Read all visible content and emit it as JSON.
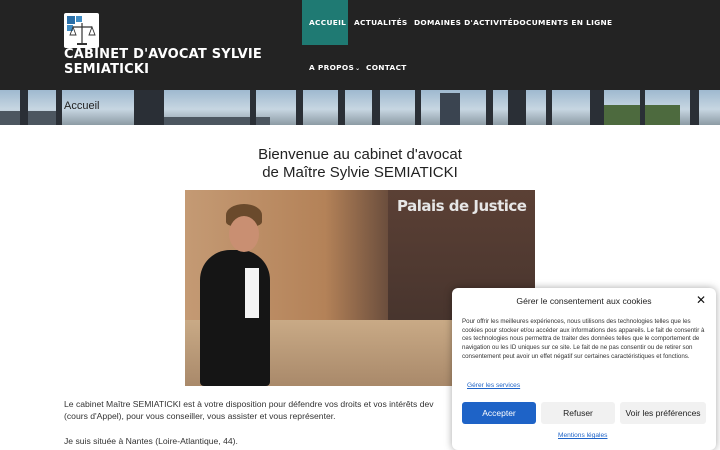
{
  "header": {
    "site_title": "CABINET D'AVOCAT SYLVIE SEMIATICKI",
    "nav": {
      "accueil": "ACCUEIL",
      "actualites": "ACTUALITÉS",
      "domaines": "DOMAINES D'ACTIVITÉ",
      "documents": "DOCUMENTS EN LIGNE",
      "apropos": "A PROPOS",
      "contact": "CONTACT"
    },
    "active_color": "#1f7a73"
  },
  "breadcrumb": {
    "home": "Accueil"
  },
  "welcome": {
    "line1": "Bienvenue au cabinet d'avocat",
    "line2": "de Maître Sylvie SEMIATICKI"
  },
  "photo": {
    "sign": "Palais de Justice"
  },
  "content": {
    "para1_line1": "Le cabinet Maître SEMIATICKI est à votre disposition pour défendre vos droits et vos intérêts dev",
    "para1_line2": "(cours d'Appel), pour vous conseiller, vous assister et vous représenter.",
    "para2": "Je suis située à Nantes (Loire-Atlantique, 44)."
  },
  "cookie": {
    "title": "Gérer le consentement aux cookies",
    "text": "Pour offrir les meilleures expériences, nous utilisons des technologies telles que les cookies pour stocker et/ou accéder aux informations des appareils. Le fait de consentir à ces technologies nous permettra de traiter des données telles que le comportement de navigation ou les ID uniques sur ce site. Le fait de ne pas consentir ou de retirer son consentement peut avoir un effet négatif sur certaines caractéristiques et fonctions.",
    "manage_services": "Gérer les services",
    "accept": "Accepter",
    "refuse": "Refuser",
    "preferences": "Voir les préférences",
    "legal": "Mentions légales",
    "accept_color": "#1e63c7"
  }
}
